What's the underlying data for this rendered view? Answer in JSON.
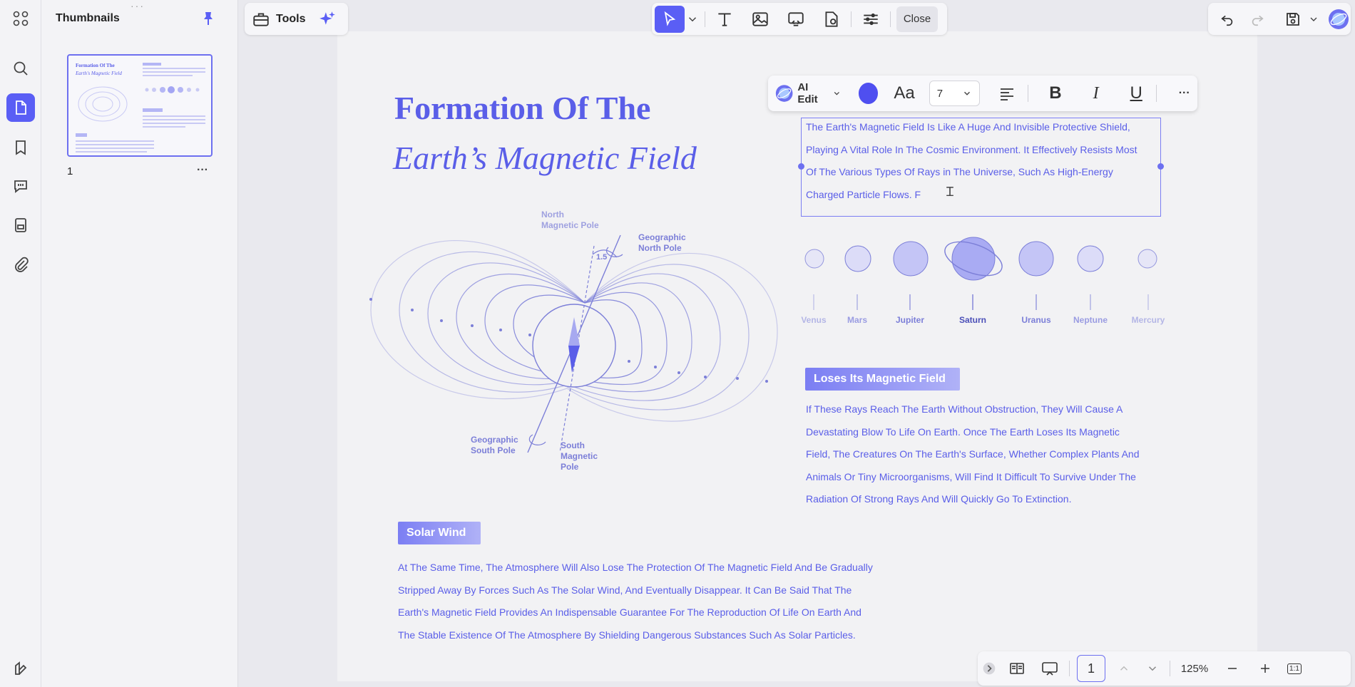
{
  "sidebar": {
    "title": "Thumbnails",
    "page_number": "1",
    "more": "···",
    "grip": "···"
  },
  "toolbar": {
    "tools_label": "Tools",
    "close_label": "Close"
  },
  "edit_toolbar": {
    "ai_label": "AI Edit",
    "font_glyph": "Aa",
    "font_size": "7",
    "bold": "B",
    "italic": "I",
    "underline": "U",
    "more": "···",
    "text_color": "#4f4ff0"
  },
  "document": {
    "title_line1": "Formation Of The",
    "title_line2": "Earth’s Magnetic Field",
    "intro_lines": [
      "The Earth's Magnetic Field Is Like A Huge And Invisible Protective Shield,",
      "Playing A Vital Role In The Cosmic Environment. It Effectively Resists Most",
      "Of The Various Types Of Rays in The Universe, Such As High-Energy",
      "Charged Particle Flows. F"
    ],
    "planets": [
      "Venus",
      "Mars",
      "Jupiter",
      "Saturn",
      "Uranus",
      "Neptune",
      "Mercury"
    ],
    "diagram": {
      "north_magnetic": [
        "North",
        "Magnetic Pole"
      ],
      "geo_north": [
        "Geographic",
        "North Pole"
      ],
      "angle": "1.5",
      "geo_south": [
        "Geographic",
        "South Pole"
      ],
      "south_magnetic": [
        "South",
        "Magnetic",
        "Pole"
      ]
    },
    "section1": {
      "heading": "Loses Its Magnetic Field",
      "lines": [
        "If These Rays Reach The Earth Without Obstruction, They Will Cause A",
        "Devastating Blow To Life On Earth. Once The Earth Loses Its Magnetic",
        "Field, The Creatures On The Earth's Surface, Whether Complex Plants And",
        "Animals Or Tiny Microorganisms, Will Find It Difficult To Survive Under The",
        "Radiation Of Strong Rays And Will Quickly Go To Extinction."
      ]
    },
    "section2": {
      "heading": "Solar Wind",
      "lines": [
        "At The Same Time, The Atmosphere Will Also Lose The Protection Of The Magnetic Field And Be Gradually",
        "Stripped Away By Forces Such As The Solar Wind, And Eventually Disappear. It Can Be Said That The",
        "Earth's Magnetic Field Provides An Indispensable Guarantee For The Reproduction Of Life On Earth And",
        "The Stable Existence Of The Atmosphere By Shielding Dangerous Substances Such As Solar Particles."
      ]
    }
  },
  "bottombar": {
    "page": "1",
    "zoom": "125%",
    "fit": "1:1"
  },
  "colors": {
    "accent": "#5a5ef5",
    "text_purple": "#5a5ee8"
  }
}
